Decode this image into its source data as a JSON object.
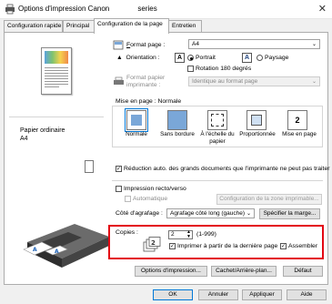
{
  "window": {
    "title": "Options d'impression Canon",
    "title_suffix": "series"
  },
  "tabs": [
    "Configuration rapide",
    "Principal",
    "Configuration de la page",
    "Entretien"
  ],
  "preview": {
    "paper_label": "Papier ordinaire",
    "paper_size": "A4"
  },
  "page_format": {
    "label": "Format page :",
    "value": "A4"
  },
  "orientation": {
    "label": "Orientation :",
    "portrait": "Portrait",
    "paysage": "Paysage",
    "rotation": "Rotation 180 degrés",
    "portrait_icon": "A",
    "paysage_icon": "A"
  },
  "printer_paper": {
    "label_line1": "Format papier",
    "label_line2": "imprimante :",
    "value": "Identique au format page"
  },
  "mise_en_page": {
    "label": "Mise en page :",
    "value": "Normale",
    "options": [
      "Normale",
      "Sans bordure",
      "À l'échelle du papier",
      "Proportionnée",
      "Mise en page"
    ]
  },
  "reduction": "Réduction auto. des grands documents que l'imprimante ne peut pas traiter",
  "duplex": {
    "label": "Impression recto/verso",
    "auto": "Automatique",
    "config_btn": "Configuration de la zone imprimable..."
  },
  "stapling": {
    "label": "Côté d'agrafage :",
    "value": "Agrafage côté long (gauche)",
    "margin_btn": "Spécifier la marge..."
  },
  "copies": {
    "label": "Copies :",
    "value": "2",
    "range": "(1-999)",
    "reverse": "Imprimer à partir de la dernière page",
    "collate": "Assembler"
  },
  "bottom_buttons": {
    "options": "Options d'impression...",
    "stamp": "Cachet/Arrière-plan...",
    "default": "Défaut"
  },
  "dialog_buttons": {
    "ok": "OK",
    "cancel": "Annuler",
    "apply": "Appliquer",
    "help": "Aide"
  }
}
